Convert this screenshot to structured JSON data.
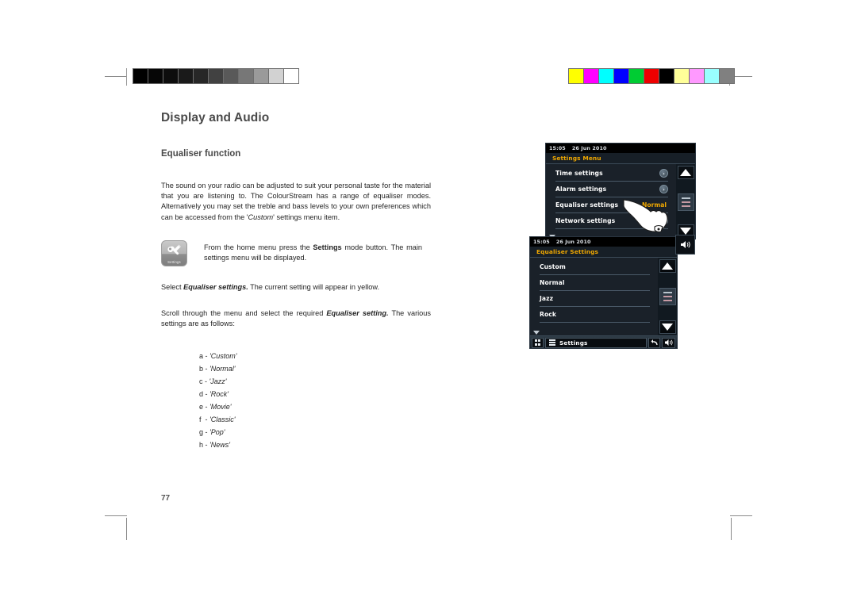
{
  "document": {
    "page_title": "Display and Audio",
    "section_title": "Equaliser function",
    "intro_paragraph": "The sound on your radio can be adjusted to suit your personal taste for the material that you are listening to. The ColourStream has a range of equaliser modes. Alternatively you may set the treble and bass levels to your own preferences which can be accessed from the 'Custom' settings menu item.",
    "step_icon_label": "Settings",
    "step_icon_name": "settings-wrench-icon",
    "step_1_text_a": "From the home menu press the ",
    "step_1_bold": "Settings",
    "step_1_text_b": " mode button. The main settings menu will be displayed.",
    "step_2_text_a": "Select ",
    "step_2_bold": "Equaliser settings.",
    "step_2_text_b": " The current setting will appear in yellow.",
    "step_3_text_a": "Scroll through the menu and select the required ",
    "step_3_bold": "Equaliser setting.",
    "step_3_text_b": " The various settings are as follows:",
    "equaliser_options": [
      {
        "letter": "a -",
        "value": "'Custom'"
      },
      {
        "letter": "b -",
        "value": "'Normal'"
      },
      {
        "letter": "c -",
        "value": "'Jazz'"
      },
      {
        "letter": "d -",
        "value": "'Rock'"
      },
      {
        "letter": "e -",
        "value": "'Movie'"
      },
      {
        "letter": "f  -",
        "value": "'Classic'"
      },
      {
        "letter": "g -",
        "value": "'Pop'"
      },
      {
        "letter": "h -",
        "value": "'News'"
      }
    ],
    "page_number": "77"
  },
  "calibration": {
    "grayscale": [
      "#000000",
      "#060606",
      "#0d0d0d",
      "#1a1a1a",
      "#272727",
      "#414141",
      "#595959",
      "#777777",
      "#9a9a9a",
      "#d2d2d2",
      "#ffffff"
    ],
    "colors": [
      "#ffff00",
      "#ff00ff",
      "#00ffff",
      "#0000ff",
      "#00cc33",
      "#ee0000",
      "#000000",
      "#ffff99",
      "#ff99ff",
      "#99ffff",
      "#808080"
    ]
  },
  "screen_settings_menu": {
    "status_time": "15:05",
    "status_date": "26 Jun 2010",
    "title": "Settings Menu",
    "items": [
      {
        "label": "Time settings",
        "value": "",
        "chevron": "›"
      },
      {
        "label": "Alarm settings",
        "value": "",
        "chevron": "›"
      },
      {
        "label": "Equaliser settings",
        "value": "Normal",
        "chevron": ""
      },
      {
        "label": "Network settings",
        "value": "",
        "chevron": "›"
      }
    ],
    "scroll_up": "▲",
    "scroll_down": "▼"
  },
  "screen_eq_settings": {
    "status_time": "15:05",
    "status_date": "26 Jun 2010",
    "title": "Equaliser Settings",
    "items": [
      {
        "label": "Custom"
      },
      {
        "label": "Normal"
      },
      {
        "label": "Jazz"
      },
      {
        "label": "Rock"
      }
    ],
    "toolbar": {
      "grid_icon": "grid-icon",
      "menu_label": "Settings",
      "back_icon": "back-arrow-icon",
      "volume_icon": "volume-icon"
    }
  },
  "colors": {
    "accent_yellow": "#f0a800",
    "screen_bg": "#1a2129",
    "title_gray": "#4a4a4a"
  }
}
